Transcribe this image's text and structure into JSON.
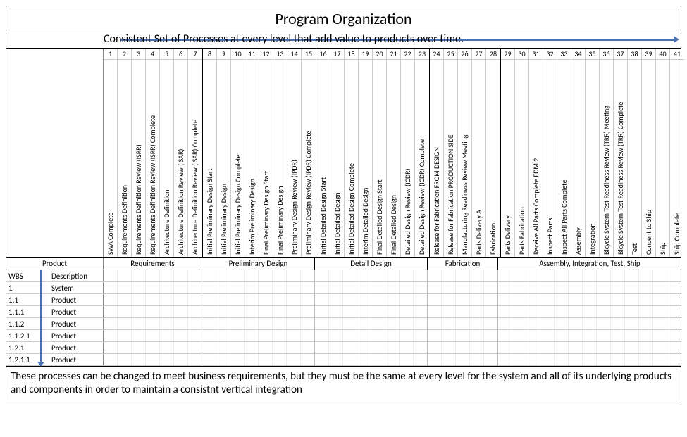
{
  "title": "Program Organization",
  "subtitle": "Consistent Set of Processes at every level that add value to products over time.",
  "phases": [
    {
      "name": "Requirements",
      "cols": [
        {
          "n": 1,
          "label": "SWA Complete"
        },
        {
          "n": 2,
          "label": "Requirements Definition"
        },
        {
          "n": 3,
          "label": "Requirements Definition Review (ISRR)"
        },
        {
          "n": 4,
          "label": "Requirements Definition Review (ISRR) Complete"
        },
        {
          "n": 5,
          "label": "Architecture Definition"
        },
        {
          "n": 6,
          "label": "Architecture Definition Review (ISAR)"
        },
        {
          "n": 7,
          "label": "Architecture Definition Review (ISAR) Complete"
        }
      ]
    },
    {
      "name": "Preliminary Design",
      "cols": [
        {
          "n": 8,
          "label": "Initial Preliminary Design Start"
        },
        {
          "n": 9,
          "label": "Initial Preliminary Design"
        },
        {
          "n": 10,
          "label": "Initial Preliminary Design Complete"
        },
        {
          "n": 11,
          "label": "Interim Preliminary Design"
        },
        {
          "n": 12,
          "label": "Final Preliminary Design Start"
        },
        {
          "n": 13,
          "label": "Final Preliminary Design"
        },
        {
          "n": 14,
          "label": "Preliminary Design Review (IPDR)"
        },
        {
          "n": 15,
          "label": "Preliminary Design Review (IPDR) Complete"
        }
      ]
    },
    {
      "name": "Detail Design",
      "cols": [
        {
          "n": 16,
          "label": "Initial Detailed Design Start"
        },
        {
          "n": 17,
          "label": "Initial Detailed Design"
        },
        {
          "n": 18,
          "label": "Initial Detailed Design Complete"
        },
        {
          "n": 19,
          "label": "Interim Detailed Design"
        },
        {
          "n": 20,
          "label": "Final Detailed Design Start"
        },
        {
          "n": 21,
          "label": "Final Detailed Design"
        },
        {
          "n": 22,
          "label": "Detailed Design Review (ICDR)"
        },
        {
          "n": 23,
          "label": "Detailed Design Review (ICDR) Complete"
        }
      ]
    },
    {
      "name": "Fabrication",
      "cols": [
        {
          "n": 24,
          "label": "Release for Fabrication FROM DESIGN"
        },
        {
          "n": 25,
          "label": "Release for Fabrication PRODUCTION SIDE"
        },
        {
          "n": 26,
          "label": "Manufacturing Readiness Review Meeting"
        },
        {
          "n": 27,
          "label": "Parts Delivery A"
        },
        {
          "n": 28,
          "label": "Fabrication"
        }
      ]
    },
    {
      "name": "Assembly, Integration, Test, Ship",
      "cols": [
        {
          "n": 29,
          "label": "Parts Delivery"
        },
        {
          "n": 30,
          "label": "Parts Fabrication"
        },
        {
          "n": 31,
          "label": "Receive All Parts Complete EDM 2"
        },
        {
          "n": 32,
          "label": "Inspect Parts"
        },
        {
          "n": 33,
          "label": "Inspect All Parts Complete"
        },
        {
          "n": 34,
          "label": "Assembly"
        },
        {
          "n": 35,
          "label": "Integration"
        },
        {
          "n": 36,
          "label": "Bicycle System Test Readiness Review (TRR) Meeting"
        },
        {
          "n": 37,
          "label": "Bicycle System Test Readiness Review (TRR) Complete"
        },
        {
          "n": 38,
          "label": "Test"
        },
        {
          "n": 39,
          "label": "Concent to Ship"
        },
        {
          "n": 40,
          "label": "Ship"
        },
        {
          "n": 41,
          "label": "Ship Complete"
        }
      ]
    }
  ],
  "product_header": "Product",
  "wbs_header": {
    "code": "WBS",
    "desc": "Description"
  },
  "wbs_rows": [
    {
      "code": "1",
      "desc": "System"
    },
    {
      "code": "1.1",
      "desc": "Product"
    },
    {
      "code": "1.1.1",
      "desc": "Product"
    },
    {
      "code": "1.1.2",
      "desc": "Product"
    },
    {
      "code": "1.1.2.1",
      "desc": "Product"
    },
    {
      "code": "1.2.1",
      "desc": "Product"
    },
    {
      "code": "1.2.1.1",
      "desc": "Product"
    }
  ],
  "footer_note": "These processes can be changed to meet business requirements, but they must be the same at every level for the system and all of its underlying products and components in order to maintain a consistnt vertical integration"
}
